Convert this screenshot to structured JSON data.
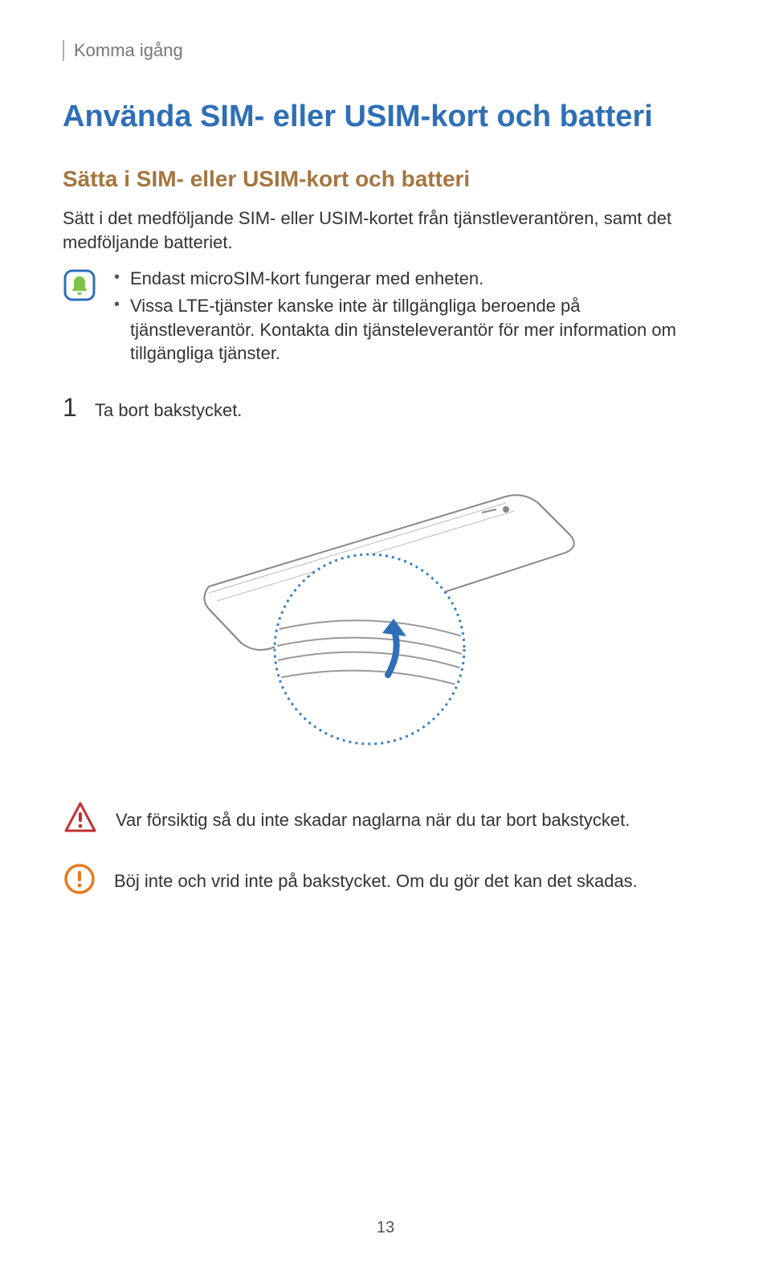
{
  "breadcrumb": "Komma igång",
  "heading1": "Använda SIM- eller USIM-kort och batteri",
  "heading2": "Sätta i SIM- eller USIM-kort och batteri",
  "intro": "Sätt i det medföljande SIM- eller USIM-kortet från tjänstleverantören, samt det medföljande batteriet.",
  "note_items": [
    "Endast microSIM-kort fungerar med enheten.",
    "Vissa LTE-tjänster kanske inte är tillgängliga beroende på tjänstleverantör. Kontakta din tjänsteleverantör för mer information om tillgängliga tjänster."
  ],
  "step1_num": "1",
  "step1_text": "Ta bort bakstycket.",
  "warning_text": "Var försiktig så du inte skadar naglarna när du tar bort bakstycket.",
  "caution_text": "Böj inte och vrid inte på bakstycket. Om du gör det kan det skadas.",
  "page_number": "13"
}
